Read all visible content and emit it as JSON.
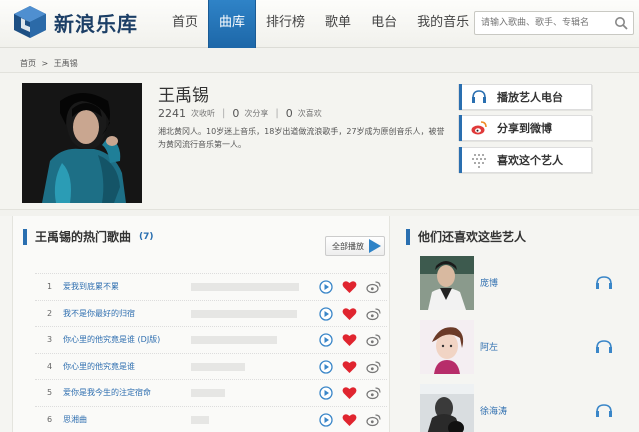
{
  "header": {
    "logo_text": "新浪乐库",
    "nav": [
      "首页",
      "曲库",
      "排行榜",
      "歌单",
      "电台",
      "我的音乐"
    ],
    "active_nav": 1,
    "search_placeholder": "请输入歌曲、歌手、专辑名"
  },
  "breadcrumb": [
    "首页",
    ">",
    "王禹锡"
  ],
  "artist": {
    "name": "王禹锡",
    "plays": "2241",
    "plays_label": "次收听",
    "shares": "0",
    "shares_label": "次分享",
    "likes": "0",
    "likes_label": "次喜欢",
    "bio": "湘北黄冈人。10岁迷上音乐，18岁出道做流浪歌手，27岁成为原创音乐人，被誉为黄冈流行音乐第一人。"
  },
  "actions": [
    {
      "label": "播放艺人电台",
      "icon": "radio-icon"
    },
    {
      "label": "分享到微博",
      "icon": "weibo-icon"
    },
    {
      "label": "喜欢这个艺人",
      "icon": "like-grid-icon"
    }
  ],
  "hot_songs": {
    "title": "王禹锡的热门歌曲",
    "count": "(7)",
    "play_all": "全部播放",
    "songs": [
      {
        "index": "1",
        "title": "爱我到底累不累",
        "popularity": 0.9
      },
      {
        "index": "2",
        "title": "我不是你最好的归宿",
        "popularity": 0.88
      },
      {
        "index": "3",
        "title": "你心里的他究竟是谁 (DJ版)",
        "popularity": 0.72
      },
      {
        "index": "4",
        "title": "你心里的他究竟是谁",
        "popularity": 0.45
      },
      {
        "index": "5",
        "title": "爱你是我今生的注定宿命",
        "popularity": 0.28
      },
      {
        "index": "6",
        "title": "思湘曲",
        "popularity": 0.15
      }
    ]
  },
  "similar": {
    "title": "他们还喜欢这些艺人",
    "artists": [
      {
        "name": "庞博"
      },
      {
        "name": "阿左"
      },
      {
        "name": "徐海涛"
      }
    ]
  }
}
